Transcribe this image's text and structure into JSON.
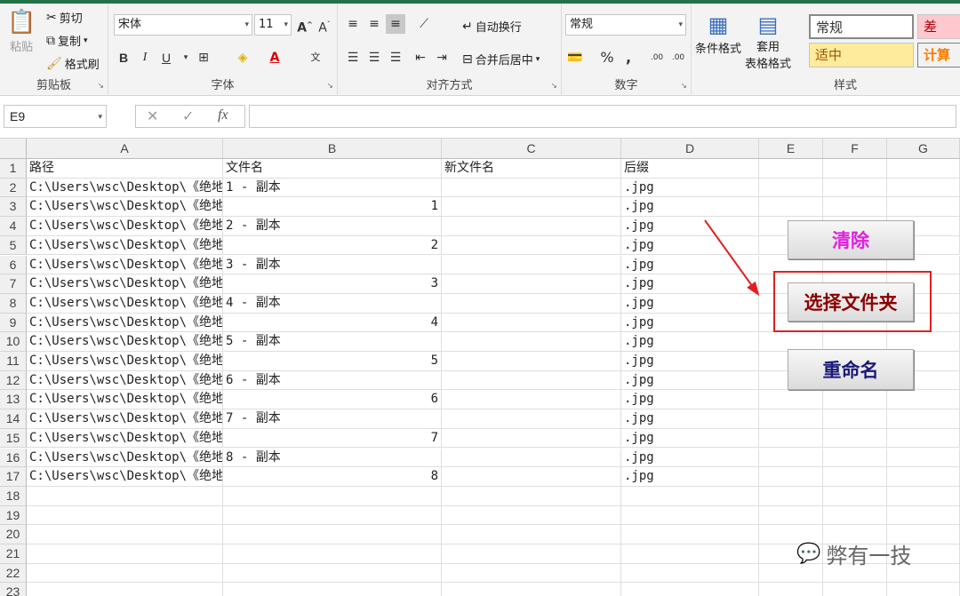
{
  "ribbon": {
    "clipboard": {
      "paste": "粘贴",
      "cut": "剪切",
      "copy": "复制",
      "format_painter": "格式刷",
      "label": "剪贴板"
    },
    "font": {
      "name": "宋体",
      "size": "11",
      "bold": "B",
      "italic": "I",
      "underline": "U",
      "font_color": "A",
      "phonetic": "文",
      "label": "字体"
    },
    "alignment": {
      "wrap_text": "自动换行",
      "merge_center": "合并后居中",
      "label": "对齐方式"
    },
    "number": {
      "format": "常规",
      "percent": "%",
      "comma": ",",
      "inc_decimal": ".00",
      "dec_decimal": ".00",
      "label": "数字"
    },
    "styles": {
      "conditional": "条件格式",
      "table_format_1": "套用",
      "table_format_2": "表格格式",
      "normal": "常规",
      "bad": "差",
      "neutral": "适中",
      "calc": "计算",
      "label": "样式"
    }
  },
  "formula_bar": {
    "name_box": "E9",
    "fx": "fx"
  },
  "columns": [
    "A",
    "B",
    "C",
    "D",
    "E",
    "F",
    "G"
  ],
  "rows": [
    "1",
    "2",
    "3",
    "4",
    "5",
    "6",
    "7",
    "8",
    "9",
    "10",
    "11",
    "12",
    "13",
    "14",
    "15",
    "16",
    "17",
    "18",
    "19",
    "20",
    "21",
    "22",
    "23"
  ],
  "headers": {
    "a": "路径",
    "b": "文件名",
    "c": "新文件名",
    "d": "后缀"
  },
  "data_rows": [
    {
      "a": "C:\\Users\\wsc\\Desktop\\《绝地",
      "b": "1 - 副本",
      "d": ".jpg",
      "num": false
    },
    {
      "a": "C:\\Users\\wsc\\Desktop\\《绝地",
      "b": "1",
      "d": ".jpg",
      "num": true
    },
    {
      "a": "C:\\Users\\wsc\\Desktop\\《绝地",
      "b": "2 - 副本",
      "d": ".jpg",
      "num": false
    },
    {
      "a": "C:\\Users\\wsc\\Desktop\\《绝地",
      "b": "2",
      "d": ".jpg",
      "num": true
    },
    {
      "a": "C:\\Users\\wsc\\Desktop\\《绝地",
      "b": "3 - 副本",
      "d": ".jpg",
      "num": false
    },
    {
      "a": "C:\\Users\\wsc\\Desktop\\《绝地",
      "b": "3",
      "d": ".jpg",
      "num": true
    },
    {
      "a": "C:\\Users\\wsc\\Desktop\\《绝地",
      "b": "4 - 副本",
      "d": ".jpg",
      "num": false
    },
    {
      "a": "C:\\Users\\wsc\\Desktop\\《绝地",
      "b": "4",
      "d": ".jpg",
      "num": true
    },
    {
      "a": "C:\\Users\\wsc\\Desktop\\《绝地",
      "b": "5 - 副本",
      "d": ".jpg",
      "num": false
    },
    {
      "a": "C:\\Users\\wsc\\Desktop\\《绝地",
      "b": "5",
      "d": ".jpg",
      "num": true
    },
    {
      "a": "C:\\Users\\wsc\\Desktop\\《绝地",
      "b": "6 - 副本",
      "d": ".jpg",
      "num": false
    },
    {
      "a": "C:\\Users\\wsc\\Desktop\\《绝地",
      "b": "6",
      "d": ".jpg",
      "num": true
    },
    {
      "a": "C:\\Users\\wsc\\Desktop\\《绝地",
      "b": "7 - 副本",
      "d": ".jpg",
      "num": false
    },
    {
      "a": "C:\\Users\\wsc\\Desktop\\《绝地",
      "b": "7",
      "d": ".jpg",
      "num": true
    },
    {
      "a": "C:\\Users\\wsc\\Desktop\\《绝地",
      "b": "8 - 副本",
      "d": ".jpg",
      "num": false
    },
    {
      "a": "C:\\Users\\wsc\\Desktop\\《绝地",
      "b": "8",
      "d": ".jpg",
      "num": true
    }
  ],
  "buttons": {
    "clear": {
      "label": "清除",
      "color": "#e020e0"
    },
    "select_folder": {
      "label": "选择文件夹",
      "color": "#8b0000"
    },
    "rename": {
      "label": "重命名",
      "color": "#1a1a7a"
    }
  },
  "watermark": {
    "text": "弊有一技"
  },
  "colors": {
    "excel_green": "#217346",
    "highlight": "#e02020",
    "bad_bg": "#ffc7ce",
    "neutral_bg": "#ffeb9c",
    "calc_fg": "#fa7d00"
  }
}
